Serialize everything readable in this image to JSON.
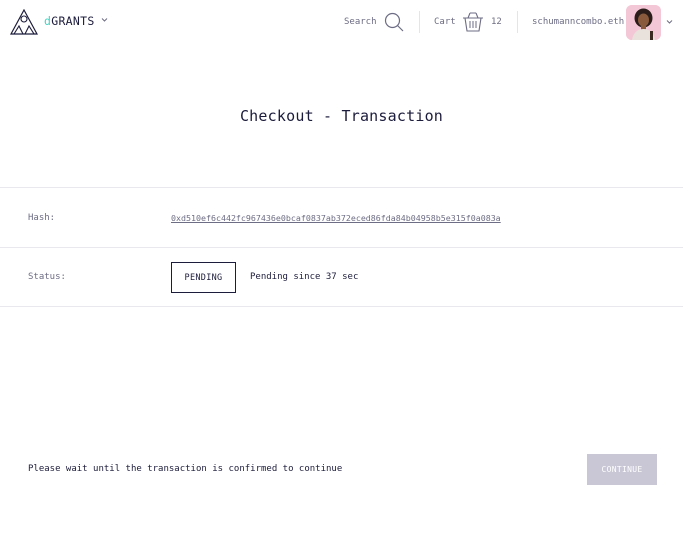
{
  "header": {
    "brand_prefix": "d",
    "brand_suffix": "GRANTS",
    "search_label": "Search",
    "cart_label": "Cart",
    "cart_count": "12",
    "user_name": "schumanncombo.eth",
    "icons": [
      "logo-icon",
      "chevron-down-icon",
      "search-icon",
      "basket-icon",
      "avatar",
      "chevron-down-icon"
    ],
    "colors": {
      "brand_accent": "#42d3c2",
      "text": "#1c1c3c",
      "muted": "#6d6d85"
    }
  },
  "main": {
    "title": "Checkout - Transaction",
    "hash_label": "Hash:",
    "hash_value": "0xd510ef6c442fc967436e0bcaf0837ab372eced86fda84b04958b5e315f0a083a",
    "status_label": "Status:",
    "status_badge": "PENDING",
    "status_text": "Pending since 37 sec"
  },
  "footer": {
    "message": "Please wait until the transaction is confirmed to continue",
    "continue_label": "CONTINUE",
    "continue_disabled": true,
    "colors": {
      "button_disabled": "#c9c7d6"
    }
  }
}
